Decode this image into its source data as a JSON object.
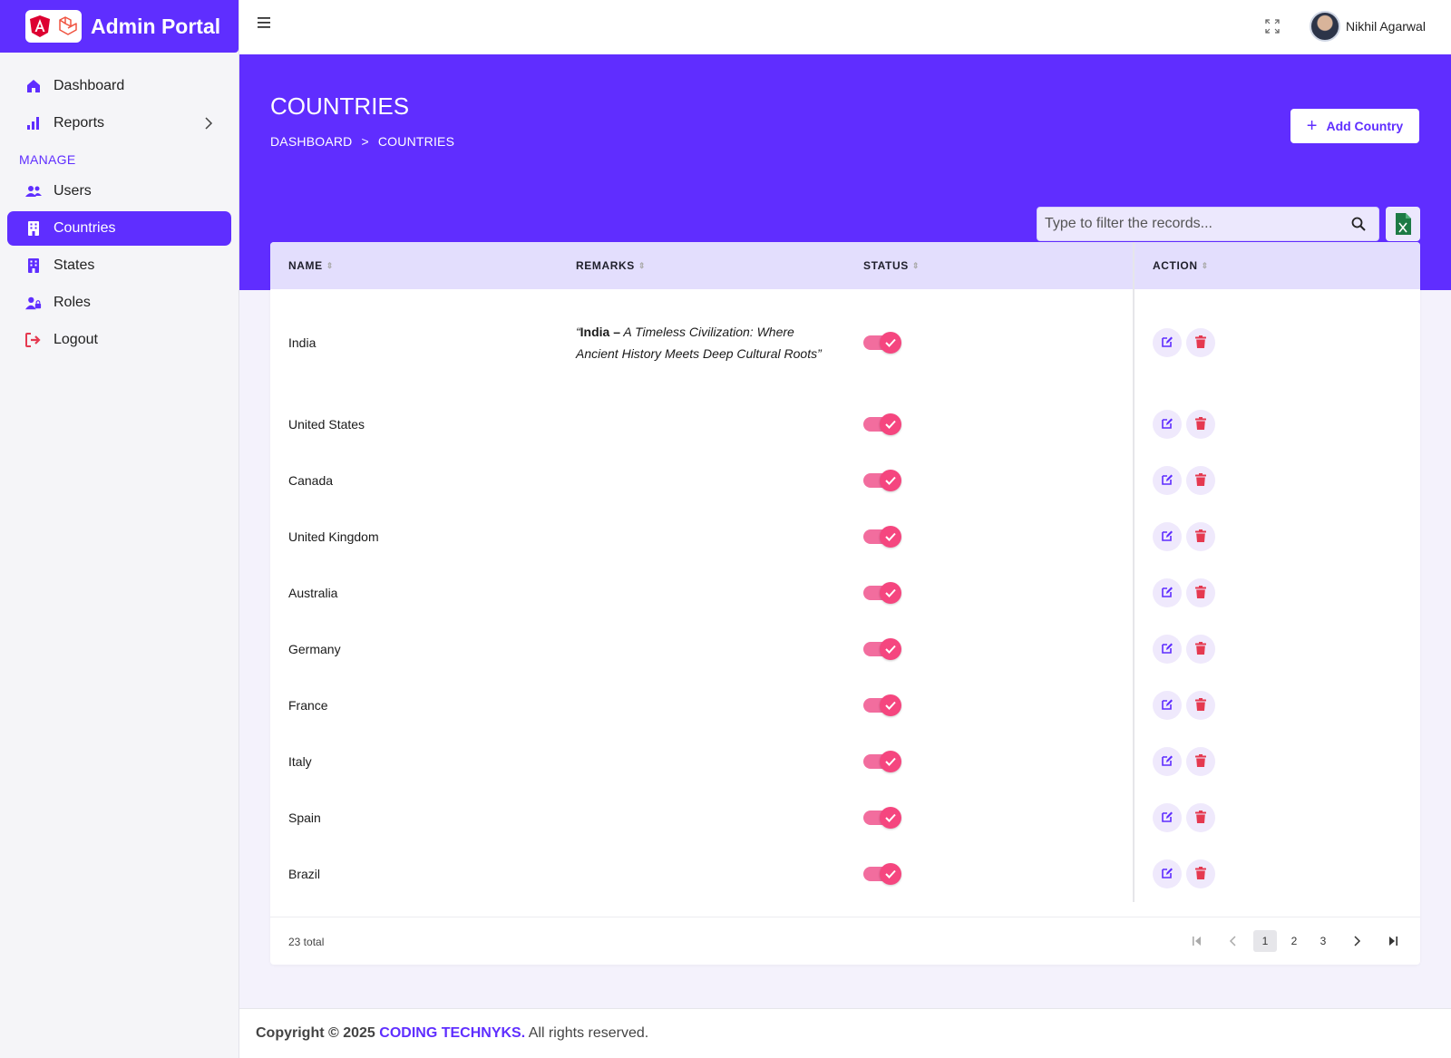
{
  "brand": {
    "title": "Admin Portal"
  },
  "sidebar": {
    "items": [
      {
        "label": "Dashboard",
        "icon": "home-icon"
      },
      {
        "label": "Reports",
        "icon": "bar-chart-icon"
      }
    ],
    "section": "MANAGE",
    "manage_items": [
      {
        "label": "Users",
        "icon": "users-icon"
      },
      {
        "label": "Countries",
        "icon": "building-icon"
      },
      {
        "label": "States",
        "icon": "building-icon"
      },
      {
        "label": "Roles",
        "icon": "user-lock-icon"
      },
      {
        "label": "Logout",
        "icon": "logout-icon"
      }
    ]
  },
  "topbar": {
    "user_name": "Nikhil Agarwal"
  },
  "header": {
    "title": "COUNTRIES",
    "breadcrumb": [
      "DASHBOARD",
      ">",
      "COUNTRIES"
    ],
    "add_button": "Add Country",
    "filter_placeholder": "Type to filter the records..."
  },
  "table": {
    "columns": [
      "NAME",
      "REMARKS",
      "STATUS",
      "ACTION"
    ],
    "rows": [
      {
        "name": "India",
        "remark_bold": "India –",
        "remark_italic": " A Timeless Civilization: Where Ancient History Meets Deep Cultural Roots",
        "status": true
      },
      {
        "name": "United States",
        "status": true
      },
      {
        "name": "Canada",
        "status": true
      },
      {
        "name": "United Kingdom",
        "status": true
      },
      {
        "name": "Australia",
        "status": true
      },
      {
        "name": "Germany",
        "status": true
      },
      {
        "name": "France",
        "status": true
      },
      {
        "name": "Italy",
        "status": true
      },
      {
        "name": "Spain",
        "status": true
      },
      {
        "name": "Brazil",
        "status": true
      }
    ],
    "total": "23 total",
    "pages": [
      "1",
      "2",
      "3"
    ],
    "current_page": "1"
  },
  "footer": {
    "prefix": "Copyright © 2025 ",
    "company": "CODING TECHNYKS.",
    "suffix": " All rights reserved."
  },
  "colors": {
    "primary": "#602dff",
    "toggle": "#f5467f",
    "delete": "#e53950"
  }
}
